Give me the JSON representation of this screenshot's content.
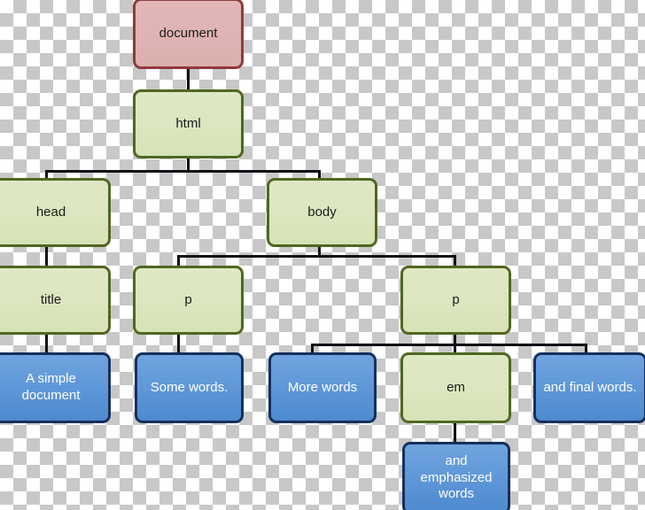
{
  "diagram": {
    "title": "HTML DOM tree diagram",
    "background": "transparency-checkerboard",
    "colors": {
      "document_fill": "#dfb3b3",
      "document_border": "#8e3b3b",
      "element_fill": "#dce6bf",
      "element_border": "#4f6820",
      "text_fill": "#5d96d8",
      "text_border": "#16305e",
      "connector": "#101018",
      "checker_light": "#ffffff",
      "checker_dark": "#c8c8c8"
    },
    "nodes": [
      {
        "id": "document",
        "label": "document",
        "kind": "document"
      },
      {
        "id": "html",
        "label": "html",
        "kind": "element"
      },
      {
        "id": "head",
        "label": "head",
        "kind": "element"
      },
      {
        "id": "body",
        "label": "body",
        "kind": "element"
      },
      {
        "id": "title",
        "label": "title",
        "kind": "element"
      },
      {
        "id": "p1",
        "label": "p",
        "kind": "element"
      },
      {
        "id": "p2",
        "label": "p",
        "kind": "element"
      },
      {
        "id": "titletext",
        "label": "A simple document",
        "kind": "text"
      },
      {
        "id": "p1text",
        "label": "Some words.",
        "kind": "text"
      },
      {
        "id": "p2text1",
        "label": "More words",
        "kind": "text"
      },
      {
        "id": "em",
        "label": "em",
        "kind": "element"
      },
      {
        "id": "p2text2",
        "label": "and final words.",
        "kind": "text"
      },
      {
        "id": "emtext",
        "label": "and emphasized words",
        "kind": "text"
      }
    ],
    "edges": [
      {
        "from": "document",
        "to": "html"
      },
      {
        "from": "html",
        "to": "head"
      },
      {
        "from": "html",
        "to": "body"
      },
      {
        "from": "head",
        "to": "title"
      },
      {
        "from": "body",
        "to": "p1"
      },
      {
        "from": "body",
        "to": "p2"
      },
      {
        "from": "title",
        "to": "titletext"
      },
      {
        "from": "p1",
        "to": "p1text"
      },
      {
        "from": "p2",
        "to": "p2text1"
      },
      {
        "from": "p2",
        "to": "em"
      },
      {
        "from": "p2",
        "to": "p2text2"
      },
      {
        "from": "em",
        "to": "emtext"
      }
    ]
  }
}
